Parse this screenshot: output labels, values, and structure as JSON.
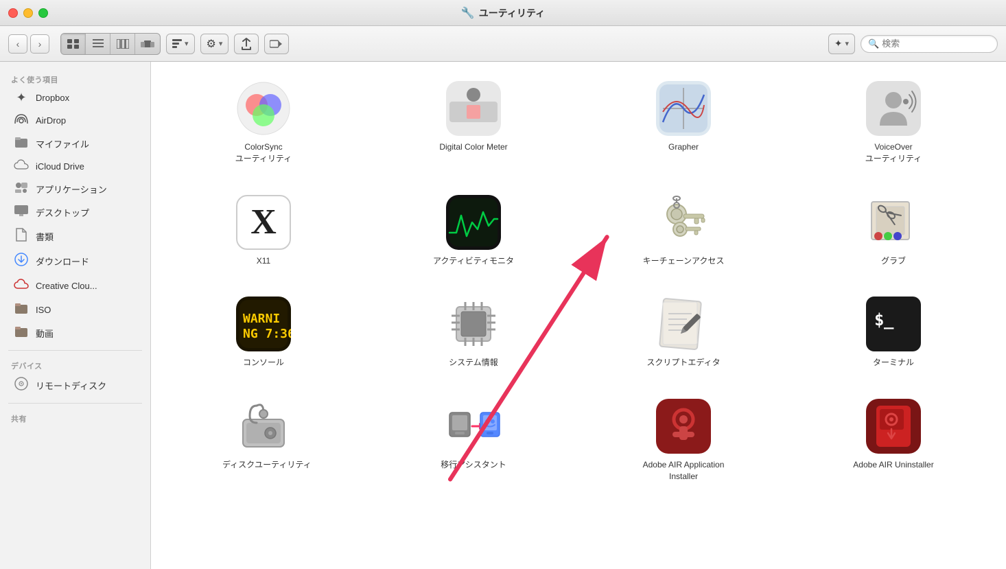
{
  "window": {
    "title": "ユーティリティ",
    "title_icon": "🔧"
  },
  "toolbar": {
    "back_label": "‹",
    "forward_label": "›",
    "view_icon": "⊞",
    "list_icon": "☰",
    "column_icon": "⊟",
    "cover_icon": "⊞",
    "arrange_icon": "⊞",
    "gear_icon": "⚙",
    "share_icon": "↑",
    "tag_icon": "⬭",
    "dropbox_icon": "✦",
    "search_placeholder": "検索",
    "search_icon": "🔍"
  },
  "sidebar": {
    "sections": [
      {
        "title": "よく使う項目",
        "items": [
          {
            "id": "dropbox",
            "icon": "✦",
            "label": "Dropbox"
          },
          {
            "id": "airdrop",
            "icon": "📡",
            "label": "AirDrop"
          },
          {
            "id": "myfiles",
            "icon": "💾",
            "label": "マイファイル"
          },
          {
            "id": "icloud",
            "icon": "☁",
            "label": "iCloud Drive"
          },
          {
            "id": "applications",
            "icon": "🎯",
            "label": "アプリケーション"
          },
          {
            "id": "desktop",
            "icon": "🖥",
            "label": "デスクトップ"
          },
          {
            "id": "documents",
            "icon": "📄",
            "label": "書類"
          },
          {
            "id": "downloads",
            "icon": "⬇",
            "label": "ダウンロード"
          },
          {
            "id": "creative",
            "icon": "🔵",
            "label": "Creative Clou..."
          },
          {
            "id": "iso",
            "icon": "📁",
            "label": "ISO"
          },
          {
            "id": "movies",
            "icon": "📁",
            "label": "動画"
          }
        ]
      },
      {
        "title": "デバイス",
        "items": [
          {
            "id": "remote-disk",
            "icon": "💿",
            "label": "リモートディスク"
          }
        ]
      },
      {
        "title": "共有",
        "items": []
      }
    ]
  },
  "grid": {
    "items": [
      {
        "id": "colorsync",
        "label": "ColorSync ユーティリティ",
        "icon_type": "colorsync"
      },
      {
        "id": "digital-color",
        "label": "Digital Color Meter",
        "icon_type": "digital-color"
      },
      {
        "id": "grapher",
        "label": "Grapher",
        "icon_type": "grapher"
      },
      {
        "id": "voiceover",
        "label": "VoiceOver ユーティリティ",
        "icon_type": "voiceover"
      },
      {
        "id": "x11",
        "label": "X11",
        "icon_type": "x11"
      },
      {
        "id": "activity",
        "label": "アクティビティモニタ",
        "icon_type": "activity"
      },
      {
        "id": "keychain",
        "label": "キーチェーンアクセス",
        "icon_type": "keychain"
      },
      {
        "id": "grab",
        "label": "グラブ",
        "icon_type": "grab"
      },
      {
        "id": "console",
        "label": "コンソール",
        "icon_type": "console"
      },
      {
        "id": "sysinfo",
        "label": "システム情報",
        "icon_type": "sysinfo"
      },
      {
        "id": "scriptedit",
        "label": "スクリプトエディタ",
        "icon_type": "scriptedit"
      },
      {
        "id": "terminal",
        "label": "ターミナル",
        "icon_type": "terminal"
      },
      {
        "id": "diskutil",
        "label": "ディスクユーティリティ",
        "icon_type": "diskutil"
      },
      {
        "id": "migration",
        "label": "移行アシスタント",
        "icon_type": "migration"
      },
      {
        "id": "adobe-air-install",
        "label": "Adobe AIR Application Installer",
        "icon_type": "adobe-air"
      },
      {
        "id": "adobe-air-uninstall",
        "label": "Adobe AIR Uninstaller",
        "icon_type": "adobe-air-uninstall"
      }
    ]
  }
}
